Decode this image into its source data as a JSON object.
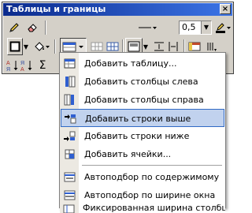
{
  "window": {
    "title": "Таблицы и границы",
    "close_glyph": "×"
  },
  "toolbar": {
    "pencil_icon": "pencil-icon",
    "eraser_icon": "eraser-icon",
    "line_weight": "0,5",
    "borders_icon": "borders-icon",
    "shading_icon": "shading-icon",
    "insert_table_icon": "insert-table-icon",
    "sort_asc_icon": "sort-ascending-icon",
    "sort_desc_icon": "sort-descending-icon",
    "sum_glyph": "Σ"
  },
  "menu": {
    "items": [
      {
        "label": "Добавить таблицу...",
        "icon": "insert-table-icon",
        "highlighted": false
      },
      {
        "label": "Добавить столбцы слева",
        "icon": "insert-columns-left-icon",
        "highlighted": false
      },
      {
        "label": "Добавить столбцы справа",
        "icon": "insert-columns-right-icon",
        "highlighted": false
      },
      {
        "label": "Добавить строки выше",
        "icon": "insert-rows-above-icon",
        "highlighted": true
      },
      {
        "label": "Добавить строки ниже",
        "icon": "insert-rows-below-icon",
        "highlighted": false
      },
      {
        "label": "Добавить ячейки...",
        "icon": "insert-cells-icon",
        "highlighted": false
      },
      {
        "label": "Автоподбор по содержимому",
        "icon": "autofit-contents-icon",
        "highlighted": false
      },
      {
        "label": "Автоподбор по ширине окна",
        "icon": "autofit-window-icon",
        "highlighted": false
      },
      {
        "label": "Фиксированная ширина столбца",
        "icon": "fixed-column-width-icon",
        "highlighted": false
      }
    ]
  },
  "colors": {
    "highlight_bg": "#c1d2ee",
    "highlight_border": "#316ac5",
    "title_bg": "#0a2a8c"
  }
}
